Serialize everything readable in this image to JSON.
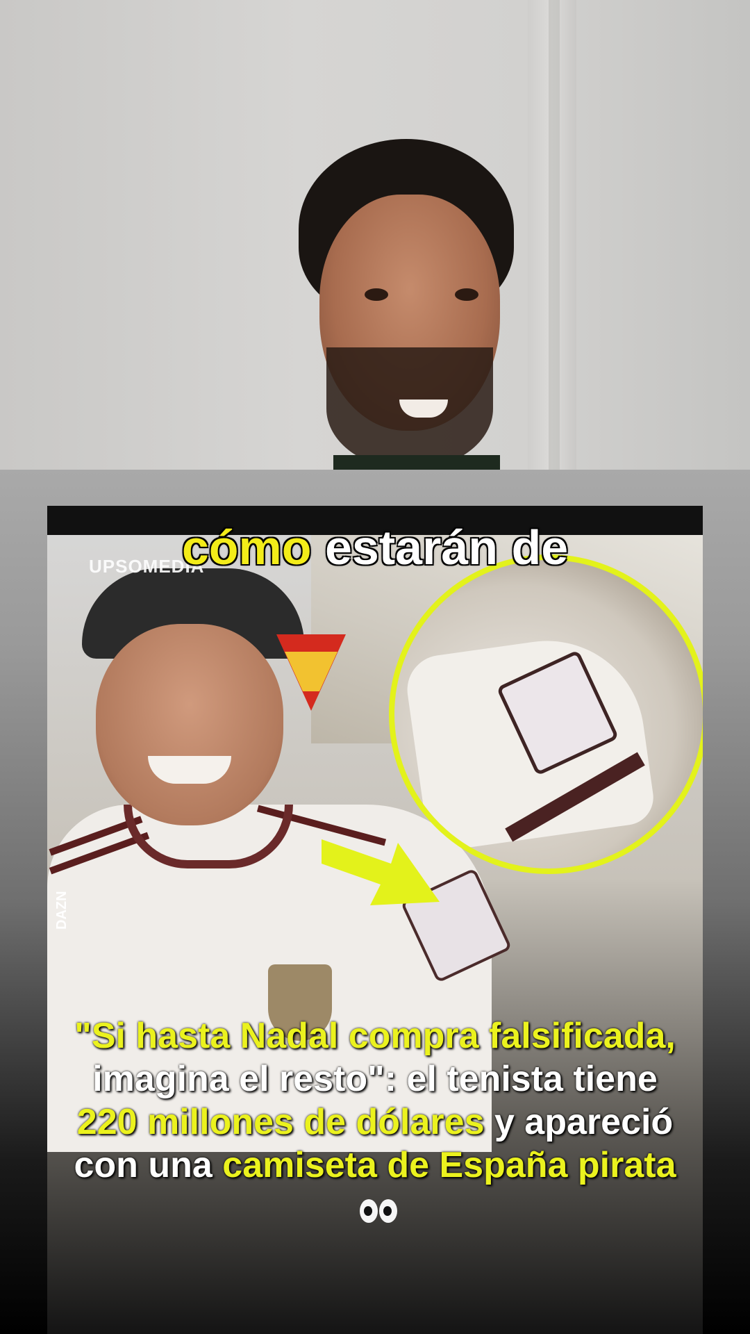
{
  "caption": {
    "highlight": "cómo",
    "rest": "estarán de"
  },
  "card": {
    "watermark": "UPSOMEDIA",
    "side_watermark": "DAZN"
  },
  "headline": {
    "part1_yellow": "\"Si hasta Nadal compra falsificada,",
    "part2_white": "imagina el resto\": el tenista tiene",
    "part3_yellow": "220 millones de dólares",
    "part4_white": "y apareció con una",
    "part5_yellow": "camiseta de España pirata",
    "emoji": "eyes-emoji"
  },
  "colors": {
    "caption_highlight": "#f3ec19",
    "headline_highlight": "#ebf21e",
    "annotation": "#e3f21b"
  }
}
